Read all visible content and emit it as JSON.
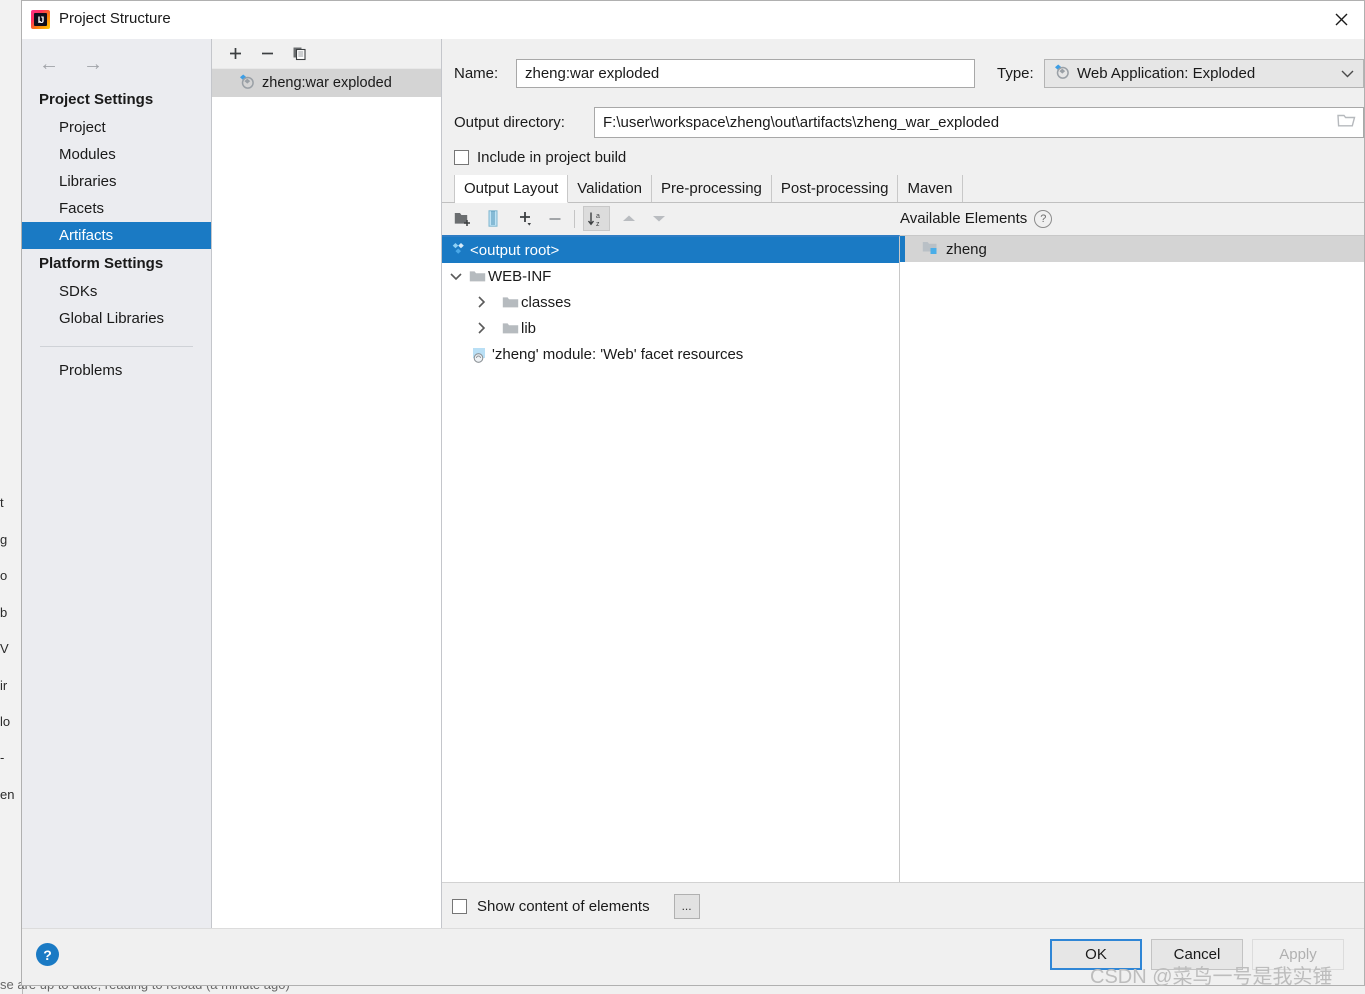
{
  "window": {
    "title": "Project Structure",
    "app_icon": "intellij-idea-icon",
    "close_icon": "close-icon"
  },
  "nav": {
    "back_icon": "arrow-left-icon",
    "forward_icon": "arrow-right-icon",
    "groups": [
      {
        "label": "Project Settings",
        "items": [
          {
            "label": "Project",
            "selected": false
          },
          {
            "label": "Modules",
            "selected": false
          },
          {
            "label": "Libraries",
            "selected": false
          },
          {
            "label": "Facets",
            "selected": false
          },
          {
            "label": "Artifacts",
            "selected": true
          }
        ]
      },
      {
        "label": "Platform Settings",
        "items": [
          {
            "label": "SDKs",
            "selected": false
          },
          {
            "label": "Global Libraries",
            "selected": false
          }
        ]
      }
    ],
    "extra": {
      "label": "Problems"
    }
  },
  "artifacts_panel": {
    "toolbar": [
      {
        "name": "add-artifact-button",
        "icon": "plus-icon"
      },
      {
        "name": "remove-artifact-button",
        "icon": "minus-icon"
      },
      {
        "name": "copy-artifact-button",
        "icon": "copy-icon"
      }
    ],
    "items": [
      {
        "label": "zheng:war exploded",
        "icon": "artifact-icon",
        "selected": true
      }
    ]
  },
  "form": {
    "name_label": "Name:",
    "name_value": "zheng:war exploded",
    "type_label": "Type:",
    "type_value": "Web Application: Exploded",
    "type_icon": "artifact-icon",
    "type_chevron": "chevron-down-icon",
    "output_dir_label": "Output directory:",
    "output_dir_value": "F:\\user\\workspace\\zheng\\out\\artifacts\\zheng_war_exploded",
    "browse_icon": "folder-icon",
    "include_in_build_label": "Include in project build",
    "include_in_build_checked": false
  },
  "tabs": [
    {
      "label": "Output Layout",
      "active": true
    },
    {
      "label": "Validation",
      "active": false
    },
    {
      "label": "Pre-processing",
      "active": false
    },
    {
      "label": "Post-processing",
      "active": false
    },
    {
      "label": "Maven",
      "active": false
    }
  ],
  "layout_toolbar": [
    {
      "name": "create-directory-button",
      "icon": "new-folder-icon"
    },
    {
      "name": "create-archive-button",
      "icon": "archive-icon"
    },
    {
      "name": "add-copy-of-button",
      "icon": "plus-dropdown-icon"
    },
    {
      "name": "remove-element-button",
      "icon": "minus-icon"
    },
    {
      "name": "sort-elements-button",
      "icon": "sort-az-icon"
    },
    {
      "name": "move-up-button",
      "icon": "triangle-up-icon"
    },
    {
      "name": "move-down-button",
      "icon": "triangle-down-icon"
    }
  ],
  "output_tree": [
    {
      "label": "<output root>",
      "icon": "artifact-root-icon",
      "depth": 0,
      "twisty": "none",
      "selected": true
    },
    {
      "label": "WEB-INF",
      "icon": "folder-icon",
      "depth": 0,
      "twisty": "expanded",
      "selected": false
    },
    {
      "label": "classes",
      "icon": "folder-icon",
      "depth": 1,
      "twisty": "collapsed",
      "selected": false
    },
    {
      "label": "lib",
      "icon": "folder-icon",
      "depth": 1,
      "twisty": "collapsed",
      "selected": false
    },
    {
      "label": "'zheng' module: 'Web' facet resources",
      "icon": "facet-resources-icon",
      "depth": 1,
      "twisty": "none",
      "selected": false
    }
  ],
  "available_elements": {
    "title": "Available Elements",
    "help_icon": "question-mark-icon",
    "items": [
      {
        "label": "zheng",
        "icon": "module-folder-icon",
        "selected": true
      }
    ]
  },
  "bottom_options": {
    "show_content_label": "Show content of elements",
    "show_content_checked": false,
    "more_button_label": "..."
  },
  "footer": {
    "help_label": "?",
    "ok_label": "OK",
    "cancel_label": "Cancel",
    "apply_label": "Apply",
    "apply_disabled": true
  },
  "watermark": {
    "text": "CSDN @菜鸟一号是我实锤"
  },
  "background": {
    "left_strip_chars": [
      "t",
      "g",
      "o",
      "b",
      "V",
      "ir",
      "lo",
      "-",
      "en"
    ],
    "bottom_text": "se are up to date; reading to reload (a minute ago)"
  },
  "colors": {
    "selection_blue": "#1a7ac4",
    "list_selection_gray": "#d4d4d4",
    "dialog_bg": "#f0f0f0",
    "nav_bg": "#ebecf0",
    "accent_border": "#2f86d6"
  }
}
